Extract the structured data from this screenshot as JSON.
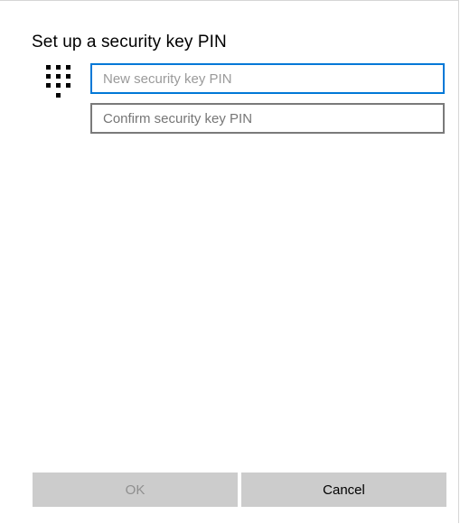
{
  "dialog": {
    "title": "Set up a security key PIN",
    "icon": "keypad-icon"
  },
  "fields": {
    "new_pin": {
      "placeholder": "New security key PIN",
      "value": ""
    },
    "confirm_pin": {
      "placeholder": "Confirm security key PIN",
      "value": ""
    }
  },
  "buttons": {
    "ok_label": "OK",
    "cancel_label": "Cancel"
  },
  "colors": {
    "focus_border": "#0078d7",
    "field_border": "#7a7a7a",
    "button_background": "#cccccc",
    "disabled_text": "#8f8f8f"
  }
}
